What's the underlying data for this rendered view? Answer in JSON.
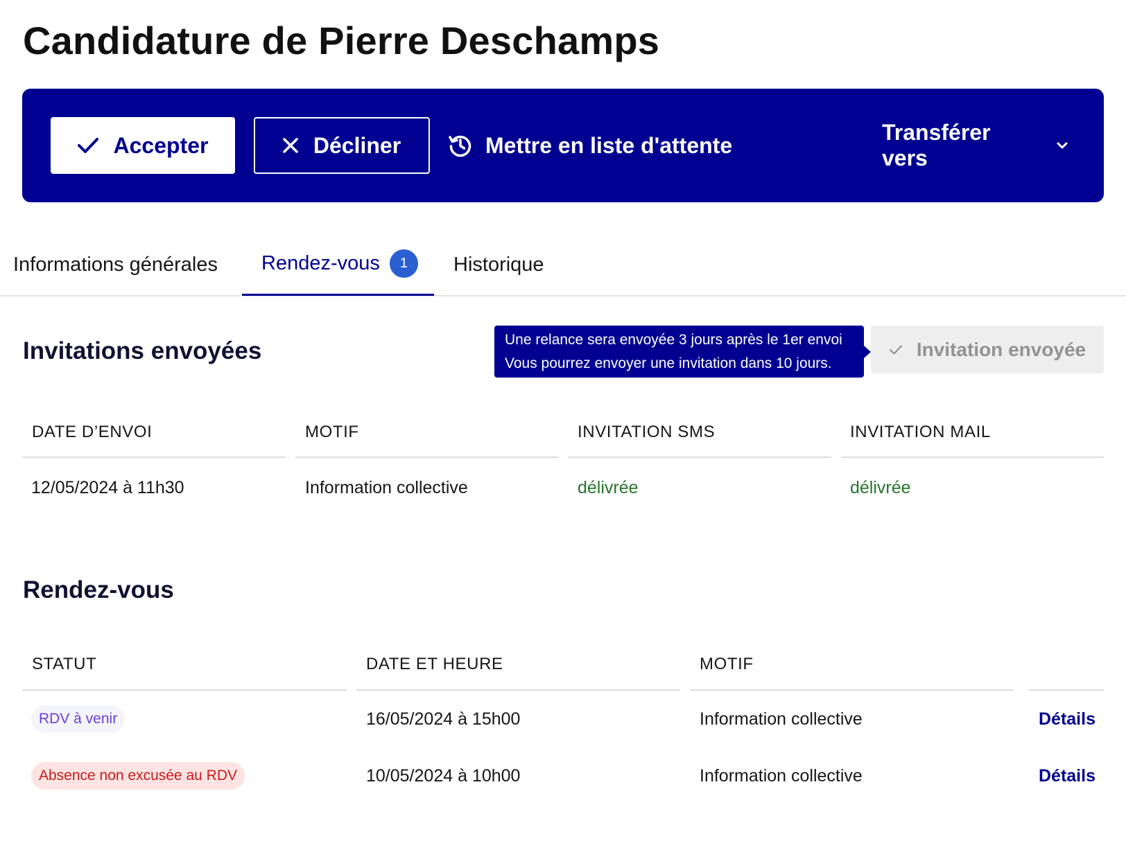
{
  "page": {
    "title": "Candidature de Pierre Deschamps"
  },
  "actions": {
    "accept_label": "Accepter",
    "decline_label": "Décliner",
    "waitlist_label": "Mettre en liste d'attente",
    "transfer_label": "Transférer vers"
  },
  "tabs": [
    {
      "label": "Informations générales"
    },
    {
      "label": "Rendez-vous",
      "badge": "1",
      "active": true
    },
    {
      "label": "Historique"
    }
  ],
  "invitations": {
    "title": "Invitations envoyées",
    "tooltip_line1": "Une relance sera envoyée 3 jours après le 1er envoi",
    "tooltip_line2": "Vous pourrez envoyer une invitation dans 10  jours.",
    "sent_button_label": "Invitation envoyée",
    "headers": [
      "DATE D’ENVOI",
      "MOTIF",
      "INVITATION SMS",
      "INVITATION MAIL"
    ],
    "rows": [
      {
        "date": "12/05/2024 à 11h30",
        "motif": "Information collective",
        "sms": "délivrée",
        "mail": "délivrée"
      }
    ]
  },
  "appointments": {
    "title": "Rendez-vous",
    "headers": [
      "STATUT",
      "DATE ET HEURE",
      "MOTIF"
    ],
    "rows": [
      {
        "status": "RDV à venir",
        "datetime": "16/05/2024 à 15h00",
        "motif": "Information collective",
        "link": "Détails"
      },
      {
        "status": "Absence non excusée au RDV",
        "datetime": "10/05/2024 à 10h00",
        "motif": "Information collective",
        "link": "Détails"
      }
    ]
  },
  "colors": {
    "primary": "#000091",
    "delivered": "#27742c",
    "upcoming_tag_bg": "#f4f4fb",
    "upcoming_tag_text": "#6a3fd6",
    "absent_tag_bg": "#fde4e2",
    "absent_tag_text": "#c9191e"
  },
  "icons": {
    "accept": "check-icon",
    "decline": "close-icon",
    "waitlist": "history-icon",
    "transfer": "chevron-down-icon",
    "sent": "check-icon"
  }
}
